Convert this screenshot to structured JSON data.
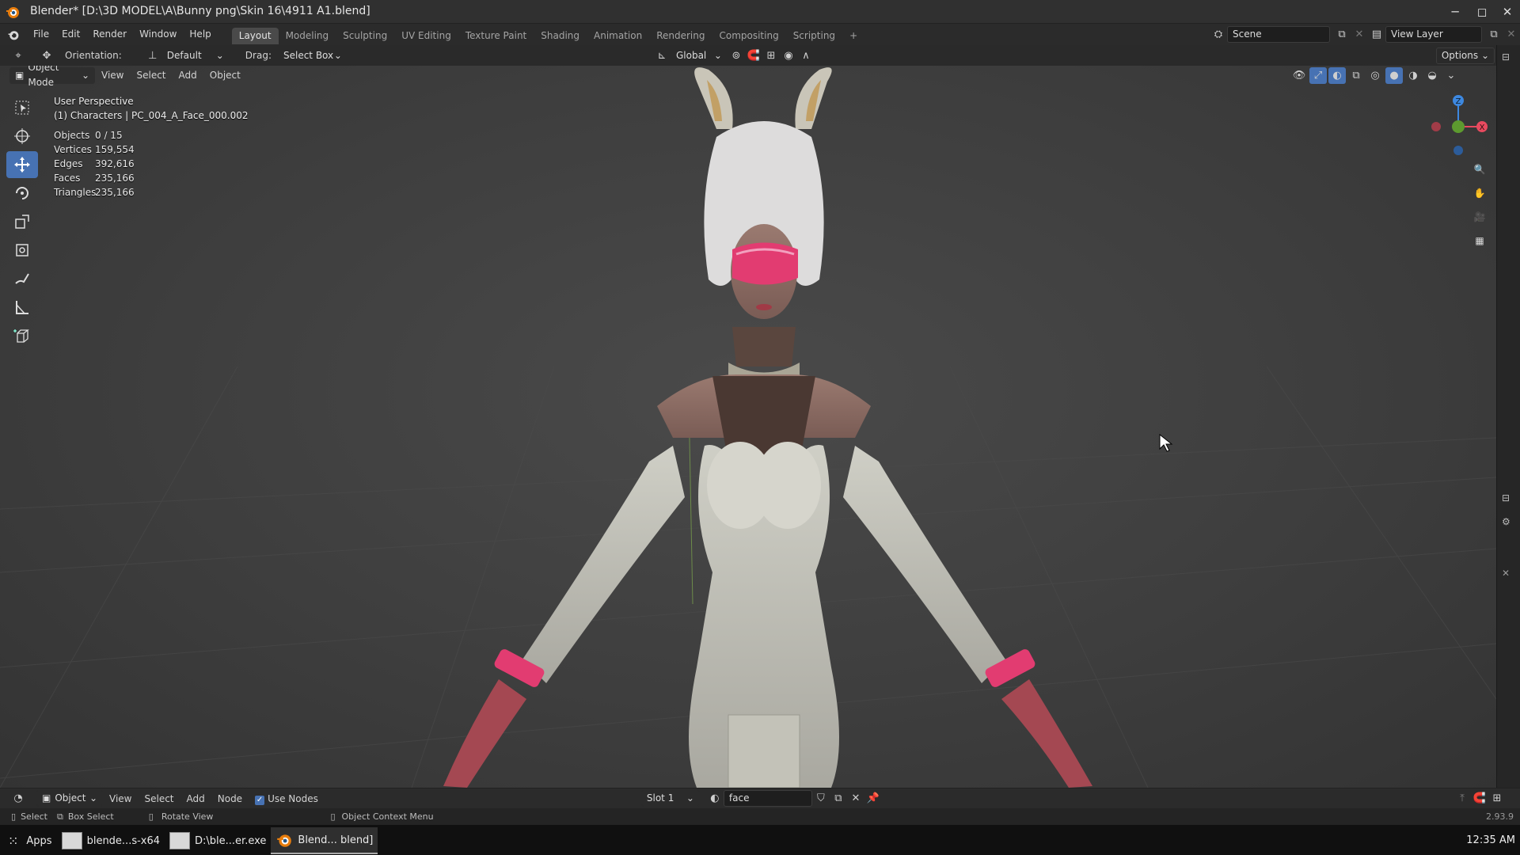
{
  "window": {
    "title": "Blender* [D:\\3D MODEL\\A\\Bunny png\\Skin 16\\4911 A1.blend]",
    "minimize": "─",
    "maximize": "◻",
    "close": "✕"
  },
  "menubar": {
    "menus": [
      "File",
      "Edit",
      "Render",
      "Window",
      "Help"
    ],
    "workspaces": [
      "Layout",
      "Modeling",
      "Sculpting",
      "UV Editing",
      "Texture Paint",
      "Shading",
      "Animation",
      "Rendering",
      "Compositing",
      "Scripting"
    ],
    "active_workspace": "Layout",
    "add_workspace": "+",
    "scene": "Scene",
    "view_layer": "View Layer"
  },
  "tool_settings": {
    "orientation_label": "Orientation:",
    "orientation_value": "Default",
    "drag_label": "Drag:",
    "drag_value": "Select Box",
    "transform_orientation": "Global",
    "options": "Options"
  },
  "viewport_header": {
    "mode": "Object Mode",
    "menus": [
      "View",
      "Select",
      "Add",
      "Object"
    ]
  },
  "viewport": {
    "perspective": "User Perspective",
    "collection": "(1) Characters | PC_004_A_Face_000.002",
    "stats": [
      {
        "label": "Objects",
        "value": "0 / 15"
      },
      {
        "label": "Vertices",
        "value": "159,554"
      },
      {
        "label": "Edges",
        "value": "392,616"
      },
      {
        "label": "Faces",
        "value": "235,166"
      },
      {
        "label": "Triangles",
        "value": "235,166"
      }
    ],
    "gizmo": {
      "z": "Z",
      "x": "X"
    }
  },
  "tools": [
    "select-box",
    "cursor",
    "move",
    "rotate",
    "scale",
    "transform",
    "annotate",
    "measure",
    "add-cube"
  ],
  "node_editor_bar": {
    "editor": "Object",
    "menus": [
      "View",
      "Select",
      "Add",
      "Node"
    ],
    "use_nodes": "Use Nodes",
    "use_nodes_checked": true,
    "slot": "Slot 1",
    "material": "face"
  },
  "statusbar": {
    "select": "Select",
    "box_select": "Box Select",
    "rotate_view": "Rotate View",
    "context_menu": "Object Context Menu",
    "version": "2.93.9"
  },
  "taskbar": {
    "apps": "Apps",
    "items": [
      {
        "label": "blende...s-x64",
        "active": false
      },
      {
        "label": "D:\\ble...er.exe",
        "active": false
      },
      {
        "label": "Blend... blend]",
        "active": true
      }
    ],
    "clock": "12:35 AM"
  },
  "colors": {
    "accent": "#4772b3",
    "axis_x": "#e84a5f",
    "axis_y": "#7fbf3f",
    "axis_z": "#3d88e0"
  }
}
